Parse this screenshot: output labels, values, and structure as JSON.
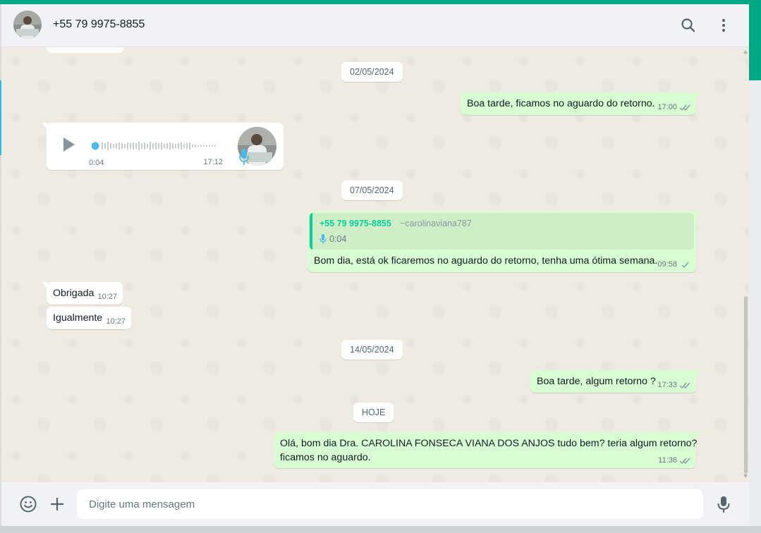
{
  "header": {
    "contact_name": "+55 79 9975-8855",
    "search_icon": "search-icon",
    "menu_icon": "kebab-menu-icon"
  },
  "messages": {
    "partial_top": {
      "time": ""
    },
    "date1": "02/05/2024",
    "m1": {
      "text": "Boa tarde, ficamos no aguardo do retorno.",
      "time": "17:00",
      "status": "read"
    },
    "audio": {
      "duration": "0:04",
      "time": "17:12"
    },
    "date2": "07/05/2024",
    "reply": {
      "quote_name": "+55 79 9975-8855",
      "quote_handle": "~carolinaviana787",
      "quote_duration": "0:04",
      "text": "Bom dia, está ok ficaremos no aguardo do retorno, tenha uma ótima semana.",
      "time": "09:58",
      "status": "sent"
    },
    "m2": {
      "text": "Obrigada",
      "time": "10:27"
    },
    "m3": {
      "text": "Igualmente",
      "time": "10:27"
    },
    "date3": "14/05/2024",
    "m4": {
      "text": "Boa tarde, algum retorno ?",
      "time": "17:33",
      "status": "read"
    },
    "date4": "HOJE",
    "m5": {
      "line1": "Olá, bom dia Dra. CAROLINA FONSECA VIANA DOS ANJOS tudo bem? teria algum retorno?",
      "line2": "ficamos no aguardo.",
      "time": "11:36",
      "status": "read"
    }
  },
  "footer": {
    "placeholder": "Digite uma mensagem",
    "emoji_icon": "emoji-icon",
    "attach_icon": "plus-icon",
    "mic_icon": "mic-icon"
  },
  "colors": {
    "accent": "#00a884",
    "outgoing_bubble": "#d9fdd3",
    "incoming_bubble": "#ffffff",
    "chat_bg": "#efeae2",
    "read_tick": "#53bdeb"
  }
}
